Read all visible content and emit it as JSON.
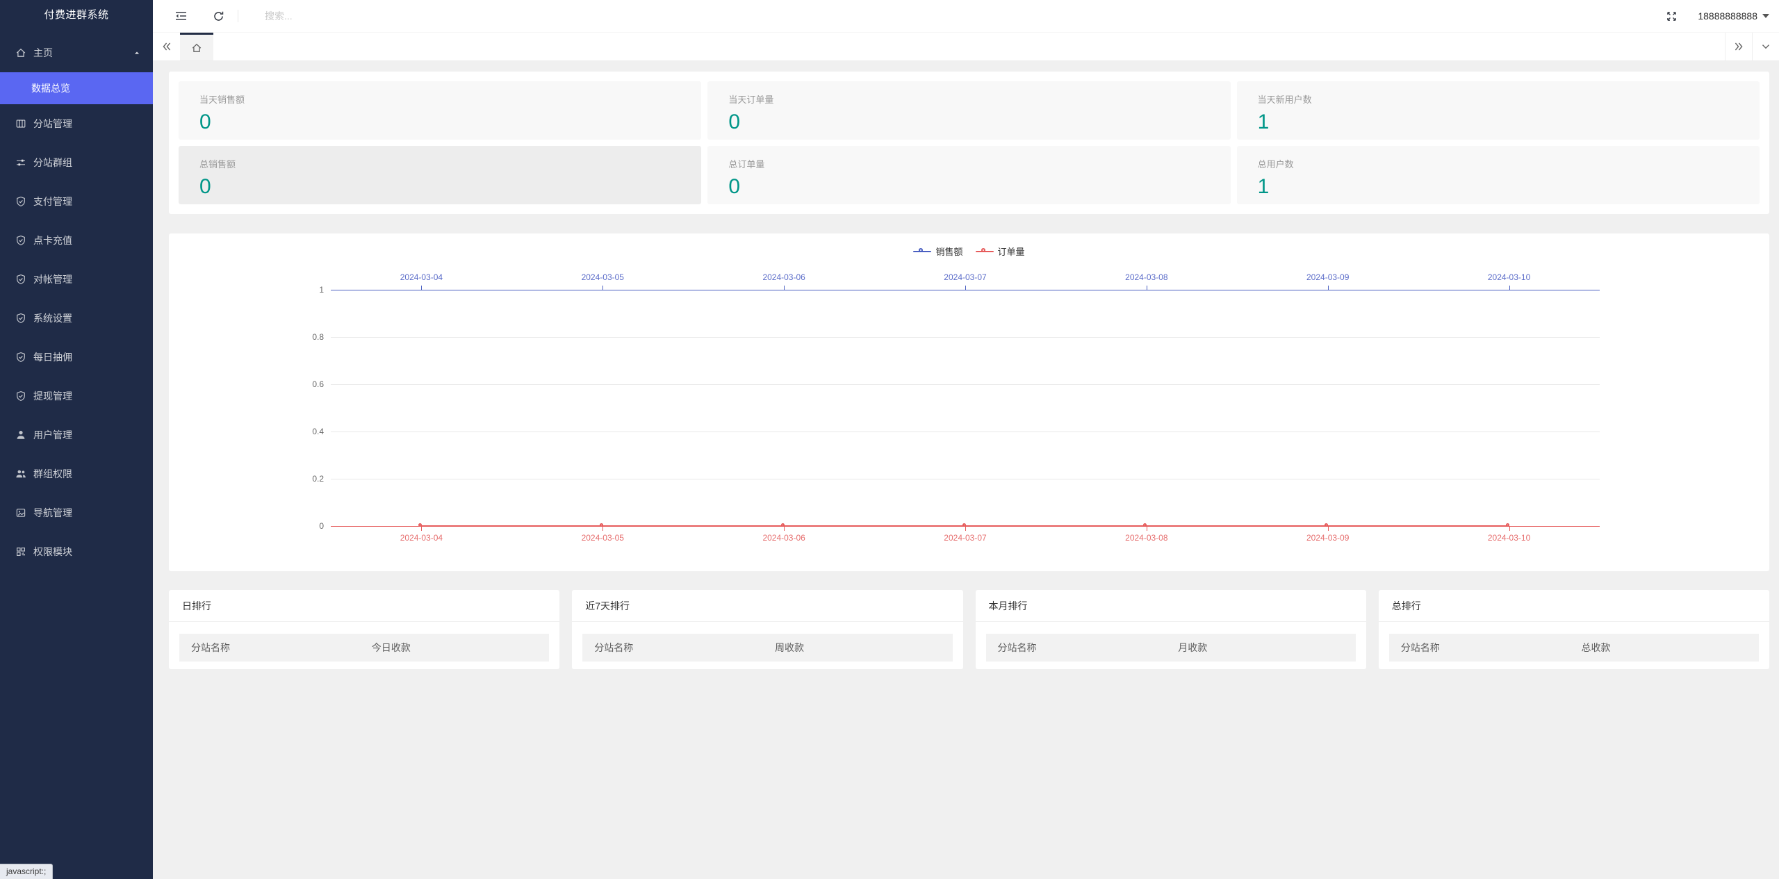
{
  "app": {
    "status_text": "javascript:;"
  },
  "sidebar": {
    "title": "付费进群系统",
    "menu": [
      {
        "key": "home",
        "label": "主页",
        "icon": "home-icon",
        "expanded": true,
        "children": [
          {
            "key": "data-overview",
            "label": "数据总览",
            "active": true
          }
        ]
      },
      {
        "key": "substation-management",
        "label": "分站管理",
        "icon": "columns-icon"
      },
      {
        "key": "substation-groups",
        "label": "分站群组",
        "icon": "sliders-icon"
      },
      {
        "key": "payment-management",
        "label": "支付管理",
        "icon": "shield-check-icon"
      },
      {
        "key": "card-recharge",
        "label": "点卡充值",
        "icon": "shield-check-icon"
      },
      {
        "key": "reconciliation-management",
        "label": "对帐管理",
        "icon": "shield-check-icon"
      },
      {
        "key": "system-settings",
        "label": "系统设置",
        "icon": "shield-check-icon"
      },
      {
        "key": "daily-commission",
        "label": "每日抽佣",
        "icon": "shield-check-icon"
      },
      {
        "key": "withdrawal-management",
        "label": "提现管理",
        "icon": "shield-check-icon"
      },
      {
        "key": "user-management",
        "label": "用户管理",
        "icon": "user-icon"
      },
      {
        "key": "group-permissions",
        "label": "群组权限",
        "icon": "users-icon"
      },
      {
        "key": "navigation-management",
        "label": "导航管理",
        "icon": "album-icon"
      },
      {
        "key": "permission-module",
        "label": "权限模块",
        "icon": "modules-icon"
      }
    ]
  },
  "header": {
    "search_placeholder": "搜索...",
    "username": "18888888888"
  },
  "stats": {
    "value_color": "#009688",
    "cards": [
      {
        "label": "当天销售额",
        "value": "0"
      },
      {
        "label": "当天订单量",
        "value": "0"
      },
      {
        "label": "当天新用户数",
        "value": "1"
      },
      {
        "label": "总销售额",
        "value": "0"
      },
      {
        "label": "总订单量",
        "value": "0"
      },
      {
        "label": "总用户数",
        "value": "1"
      }
    ]
  },
  "chart_data": {
    "type": "line",
    "x": [
      "2024-03-04",
      "2024-03-05",
      "2024-03-06",
      "2024-03-07",
      "2024-03-08",
      "2024-03-09",
      "2024-03-10"
    ],
    "series": [
      {
        "name": "销售额",
        "values": [
          0,
          0,
          0,
          0,
          0,
          0,
          0
        ],
        "color": "#4a5fc1",
        "label_color": "#5b6cc9",
        "x_axis": "top"
      },
      {
        "name": "订单量",
        "values": [
          0,
          0,
          0,
          0,
          0,
          0,
          0
        ],
        "color": "#e65b5b",
        "label_color": "#e66e6e",
        "x_axis": "bottom"
      }
    ],
    "ylim": [
      0,
      1
    ],
    "yticks": [
      0,
      0.2,
      0.4,
      0.6,
      0.8,
      1
    ],
    "legend_position": "top-center",
    "grid": "horizontal",
    "title": ""
  },
  "rankings": [
    {
      "key": "daily",
      "title": "日排行",
      "columns": [
        "分站名称",
        "今日收款"
      ],
      "rows": []
    },
    {
      "key": "last7days",
      "title": "近7天排行",
      "columns": [
        "分站名称",
        "周收款"
      ],
      "rows": []
    },
    {
      "key": "monthly",
      "title": "本月排行",
      "columns": [
        "分站名称",
        "月收款"
      ],
      "rows": []
    },
    {
      "key": "total",
      "title": "总排行",
      "columns": [
        "分站名称",
        "总收款"
      ],
      "rows": []
    }
  ],
  "theme": {
    "sidebar_bg": "#1f2b47",
    "active_item_bg": "#5a67f2",
    "stat_value_color": "#009688",
    "series_blue": "#4a5fc1",
    "series_red": "#e65b5b"
  }
}
